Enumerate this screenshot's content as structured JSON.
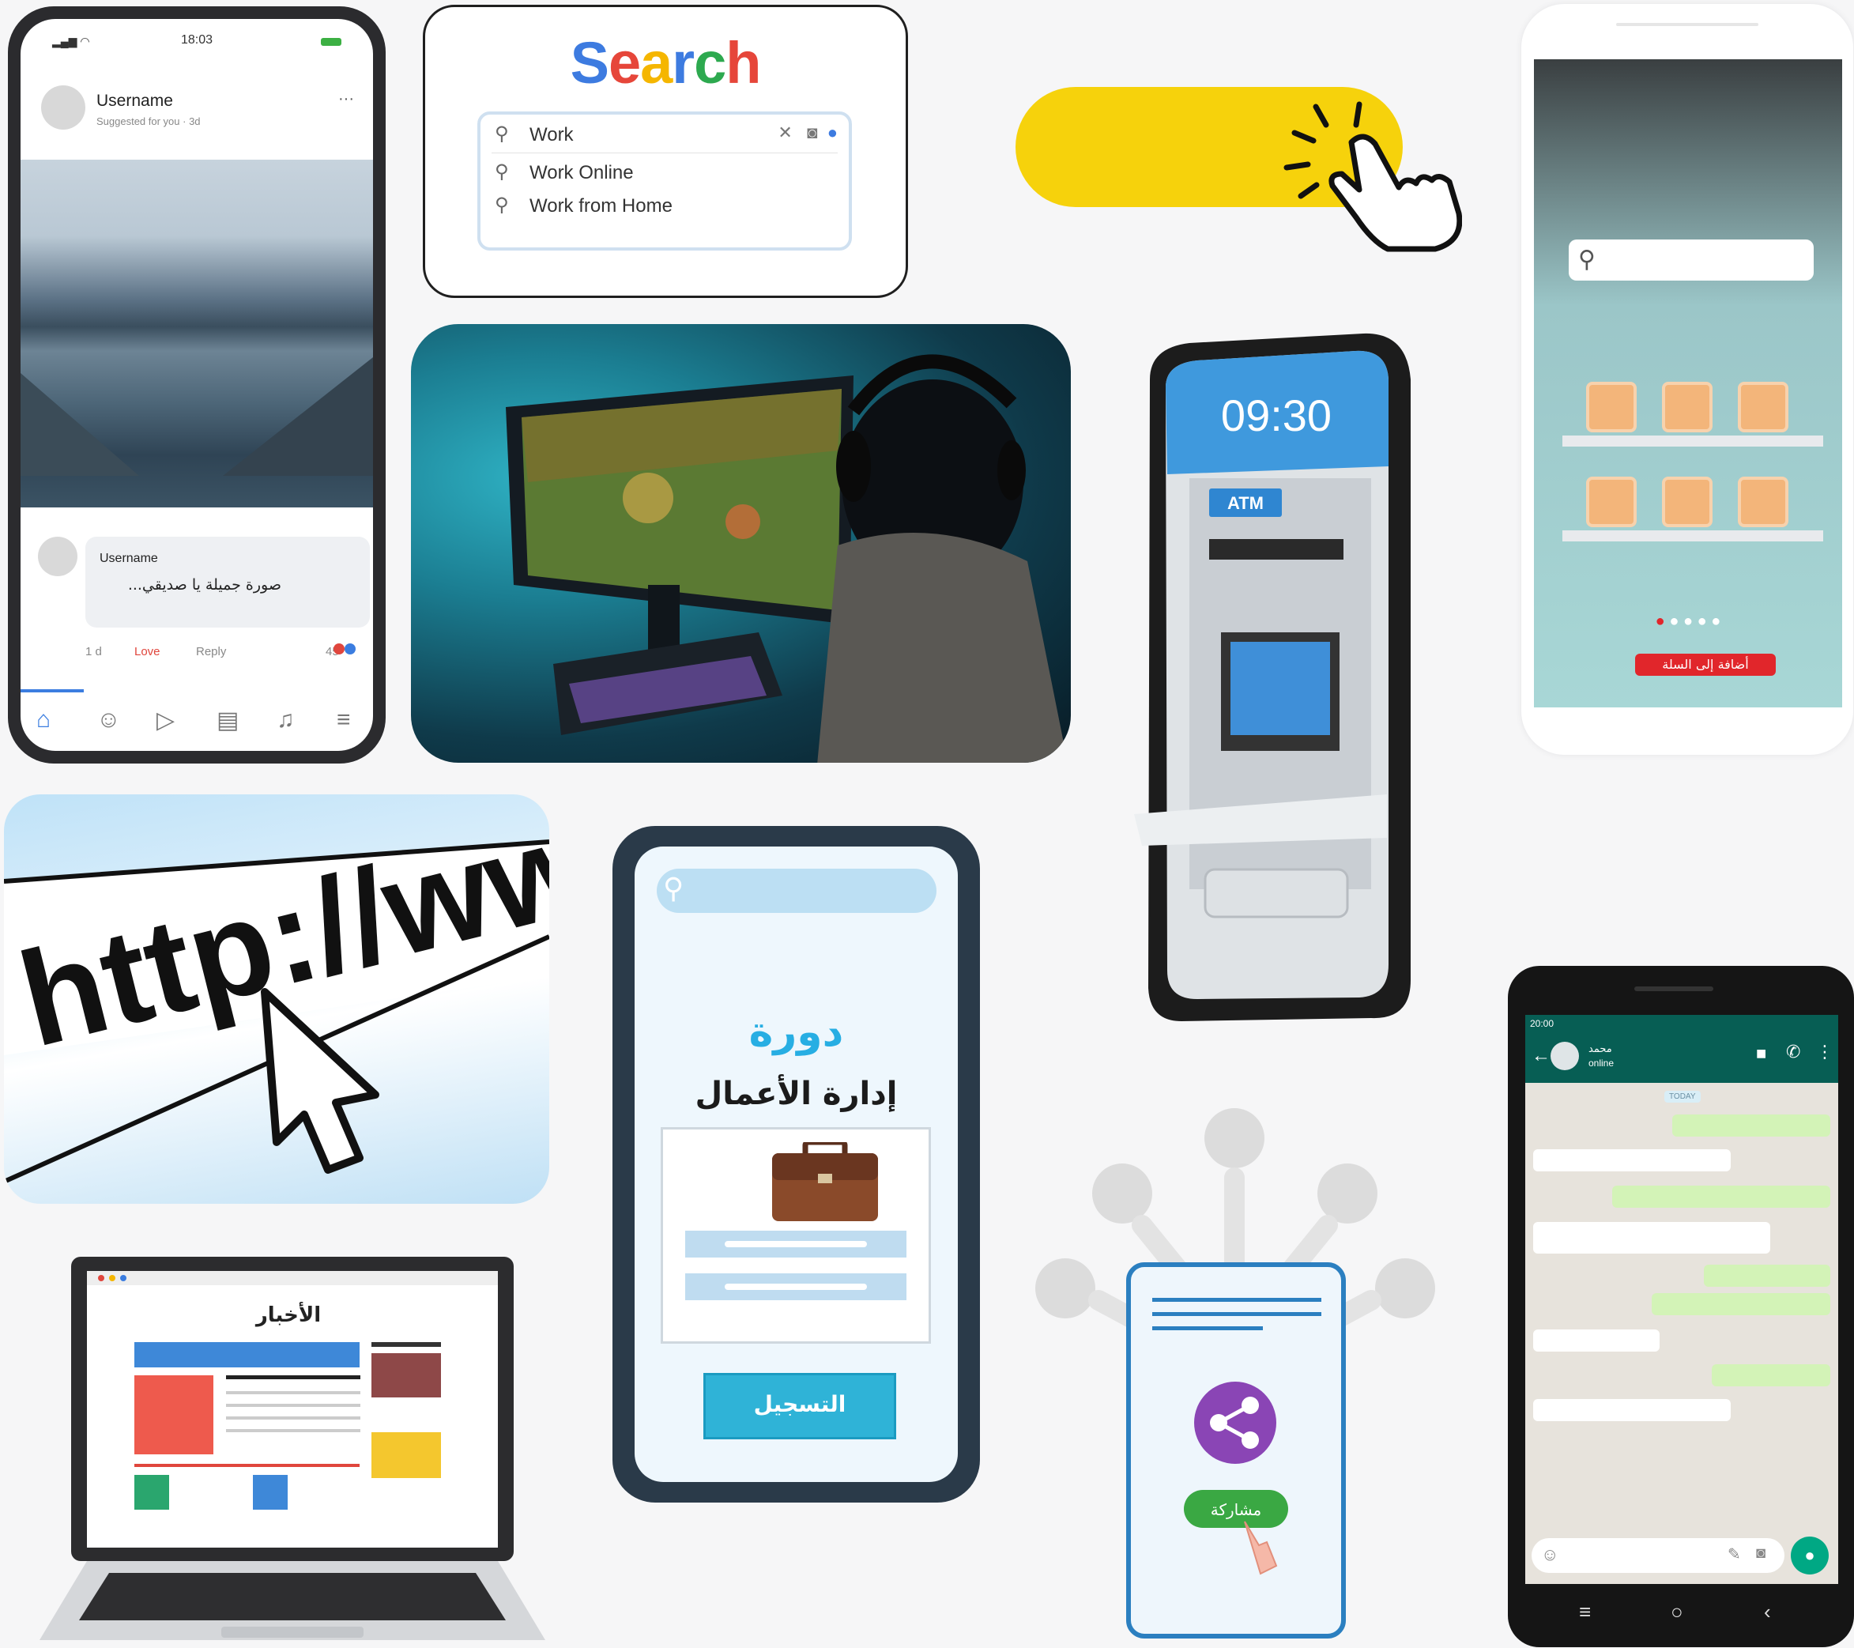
{
  "social_post": {
    "status_time": "18:03",
    "username": "Username",
    "subtitle": "Suggested for you · 3d",
    "more": "···",
    "comment_username": "Username",
    "comment_text": "صورة جميلة يا صديقي...",
    "meta_time": "1 d",
    "meta_love": "Love",
    "meta_reply": "Reply",
    "reaction_count": "45"
  },
  "search_widget": {
    "title_letters": [
      {
        "ch": "S",
        "color": "#3d7be0"
      },
      {
        "ch": "e",
        "color": "#e6463a"
      },
      {
        "ch": "a",
        "color": "#f5b600"
      },
      {
        "ch": "r",
        "color": "#3d7be0"
      },
      {
        "ch": "c",
        "color": "#2da94f"
      },
      {
        "ch": "h",
        "color": "#e6463a"
      }
    ],
    "query": "Work",
    "suggestions": [
      "Work Online",
      "Work from Home"
    ]
  },
  "shop_app": {
    "add_to_cart": "أضافة إلى السلة"
  },
  "atm_app": {
    "clock": "09:30",
    "atm_label": "ATM"
  },
  "http_banner": {
    "text": "http://www"
  },
  "course_app": {
    "title_line1": "دورة",
    "title_line2": "إدارة الأعمال",
    "register_button": "التسجيل"
  },
  "news_laptop": {
    "heading": "الأخبار"
  },
  "share_app": {
    "share_button": "مشاركة"
  },
  "chat_app": {
    "status_time": "20:00",
    "contact_name": "محمد",
    "contact_status": "online",
    "date_chip": "TODAY"
  }
}
